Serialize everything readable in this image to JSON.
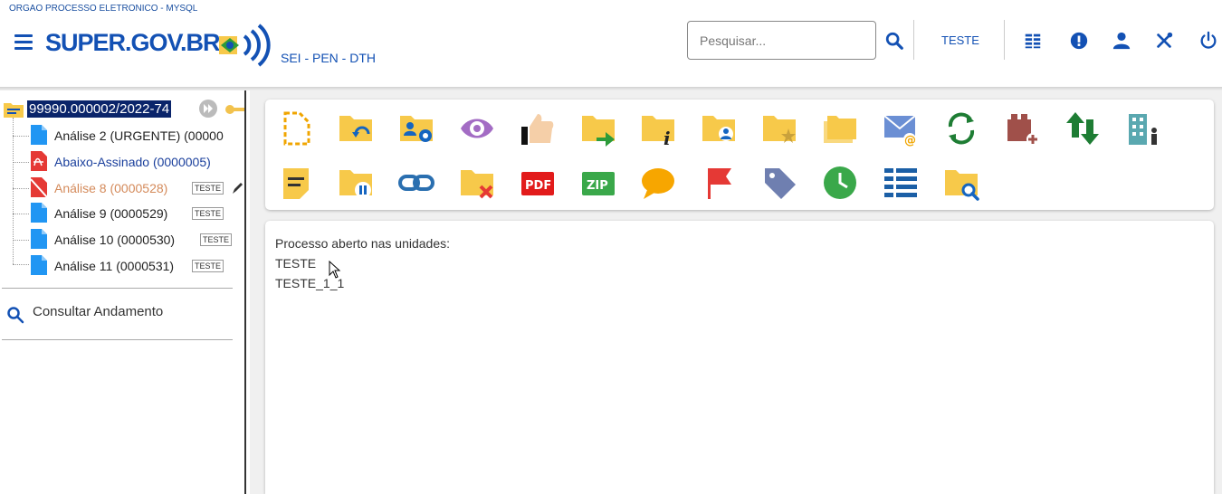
{
  "header": {
    "org_name": "ORGAO PROCESSO ELETRONICO - MYSQL",
    "logo_text": "SUPER.GOV.BR",
    "subtitle": "SEI - PEN - DTH",
    "search_placeholder": "Pesquisar...",
    "unit": "TESTE"
  },
  "tree": {
    "process_number": "99990.000002/2022-74",
    "documents": [
      {
        "label": "Análise 2 (URGENTE) (00000",
        "badge": "",
        "color": "#222",
        "icon": "doc-icon"
      },
      {
        "label": "Abaixo-Assinado (0000005)",
        "badge": "",
        "color": "#1a3f9c",
        "icon": "pdf-icon"
      },
      {
        "label": "Análise 8 (0000528)",
        "badge": "TESTE",
        "color": "#d48a5a",
        "icon": "canceled-doc-icon"
      },
      {
        "label": "Análise 9 (0000529)",
        "badge": "TESTE",
        "color": "#222",
        "icon": "doc-icon"
      },
      {
        "label": "Análise 10 (0000530)",
        "badge": "TESTE",
        "color": "#222",
        "icon": "doc-icon"
      },
      {
        "label": "Análise 11 (0000531)",
        "badge": "TESTE",
        "color": "#222",
        "icon": "doc-icon"
      }
    ],
    "consult_label": "Consultar Andamento"
  },
  "content": {
    "heading": "Processo aberto nas unidades:",
    "units": [
      "TESTE",
      "TESTE_1_1"
    ]
  },
  "toolbar_icons": {
    "row1": [
      "new-document-icon",
      "reopen-folder-icon",
      "folder-users-settings-icon",
      "eye-icon",
      "thumbs-up-icon",
      "send-folder-icon",
      "folder-info-icon",
      "folder-user-icon",
      "folder-star-icon",
      "folders-icon",
      "email-icon",
      "refresh-icon",
      "add-block-icon",
      "transfer-arrows-icon",
      "building-person-icon"
    ],
    "row2": [
      "note-icon",
      "pause-folder-icon",
      "link-icon",
      "remove-folder-icon",
      "pdf-icon",
      "zip-icon",
      "comment-icon",
      "flag-icon",
      "tag-icon",
      "clock-icon",
      "list-icon",
      "search-folder-icon"
    ]
  },
  "colors": {
    "brand_blue": "#1351b4",
    "folder_yellow": "#f7c94a",
    "selection_bg": "#0a246a"
  }
}
